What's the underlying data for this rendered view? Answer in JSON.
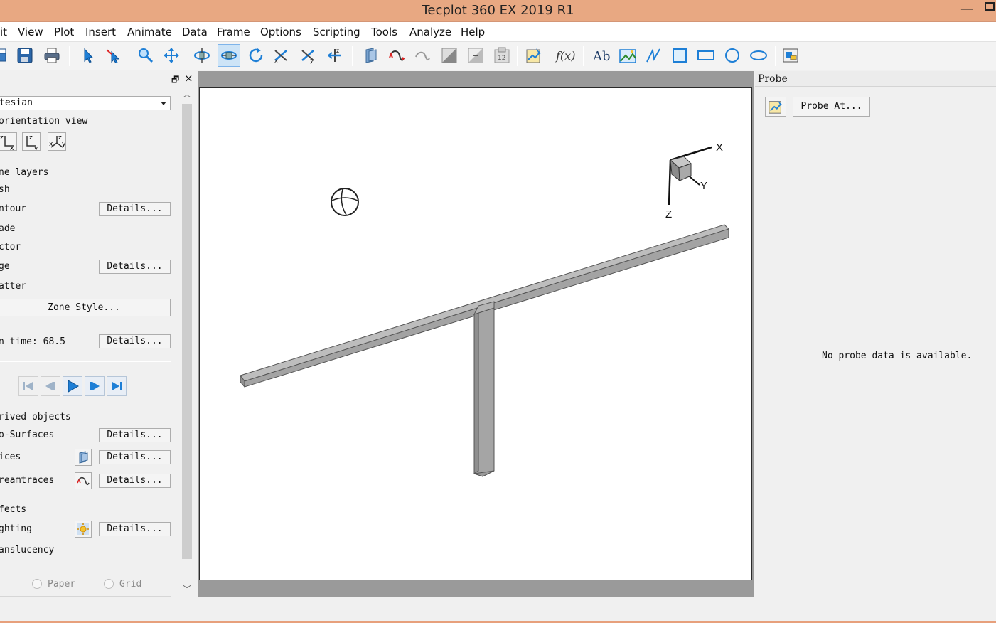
{
  "window": {
    "title": "Tecplot 360 EX 2019 R1",
    "minimize_glyph": "—"
  },
  "menu": {
    "items": [
      "it",
      "View",
      "Plot",
      "Insert",
      "Animate",
      "Data",
      "Frame",
      "Options",
      "Scripting",
      "Tools",
      "Analyze",
      "Help"
    ]
  },
  "toolbar": {
    "icons": [
      "open-icon",
      "save-icon",
      "print-icon",
      "selector-icon",
      "adjustor-icon",
      "zoom-icon",
      "translate-icon",
      "rotate-3d-icon",
      "rotate-axis-icon",
      "spherical-rotate-icon",
      "rollerball-icon",
      "twist-icon",
      "probe-rotate-icon",
      "slice-tool-icon",
      "streamtrace-tool-icon",
      "streamtrace-undo-icon",
      "contour-add-icon",
      "contour-remove-icon",
      "contour-level-icon",
      "probe-tool-icon",
      "function-icon",
      "text-icon",
      "image-icon",
      "polyline-icon",
      "square-icon",
      "rectangle-icon",
      "circle-icon",
      "ellipse-icon",
      "frame-icon"
    ],
    "function_label": "f(x)",
    "text_label": "Ab"
  },
  "left_panel": {
    "plot_type": "tesian",
    "orientation_label": "orientation view",
    "orientation_buttons": [
      "z x",
      "z y",
      "x y"
    ],
    "zone_layers_label": "ne layers",
    "layers": [
      {
        "label": "sh",
        "has_details": false
      },
      {
        "label": "ntour",
        "has_details": true
      },
      {
        "label": "ade",
        "has_details": false
      },
      {
        "label": "ctor",
        "has_details": false
      },
      {
        "label": "ge",
        "has_details": true
      },
      {
        "label": "atter",
        "has_details": false
      }
    ],
    "details_label": "Details...",
    "zone_style_label": "Zone Style...",
    "time_label": "n time: 68.5",
    "derived_label": "rived objects",
    "derived": [
      "o-Surfaces",
      "ices",
      "reamtraces"
    ],
    "effects_label": "fects",
    "lighting_label": "ghting",
    "translucency_label": "anslucency",
    "radio_paper": "Paper",
    "radio_grid": "Grid"
  },
  "graphics": {
    "axis_labels": {
      "x": "X",
      "y": "Y",
      "z": "Z"
    }
  },
  "probe_panel": {
    "header": "Probe",
    "probe_at_label": "Probe At...",
    "message": "No probe data is available."
  },
  "colors": {
    "titlebar": "#e8a882",
    "accent": "#1e7fd6",
    "beam": "#a9a9a9"
  }
}
